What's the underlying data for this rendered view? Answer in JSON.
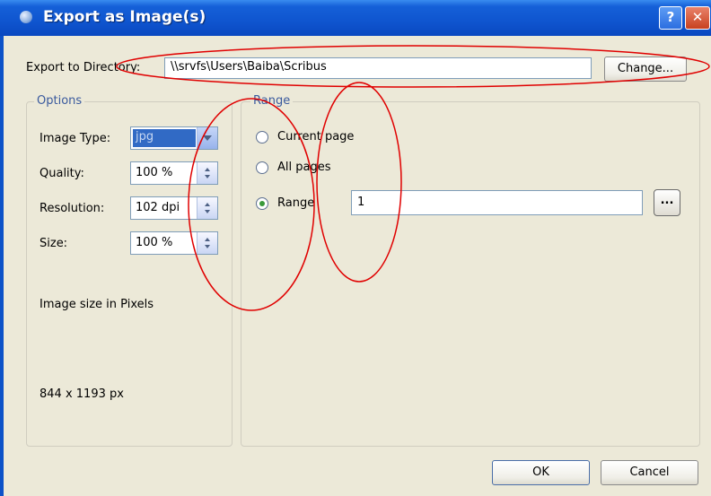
{
  "window": {
    "title": "Export as Image(s)",
    "help_glyph": "?",
    "close_glyph": "✕"
  },
  "directory": {
    "label": "Export to Directory:",
    "value": "\\\\srvfs\\Users\\Baiba\\Scribus",
    "change_button": "Change..."
  },
  "options": {
    "title": "Options",
    "image_type_label": "Image Type:",
    "image_type_value": "jpg",
    "quality_label": "Quality:",
    "quality_value": "100 %",
    "resolution_label": "Resolution:",
    "resolution_value": "102 dpi",
    "size_label": "Size:",
    "size_value": "100 %",
    "pixels_label": "Image size in Pixels",
    "pixels_value": "844 x 1193 px"
  },
  "range": {
    "title": "Range",
    "current_page": "Current page",
    "all_pages": "All pages",
    "range_label": "Range",
    "range_value": "1",
    "browse_button": "...",
    "selected": "range"
  },
  "footer": {
    "ok": "OK",
    "cancel": "Cancel"
  },
  "colors": {
    "titlebar": "#0f55cf",
    "dialog_bg": "#ece9d8",
    "annotation": "#e00000",
    "selection": "#316ac5"
  }
}
